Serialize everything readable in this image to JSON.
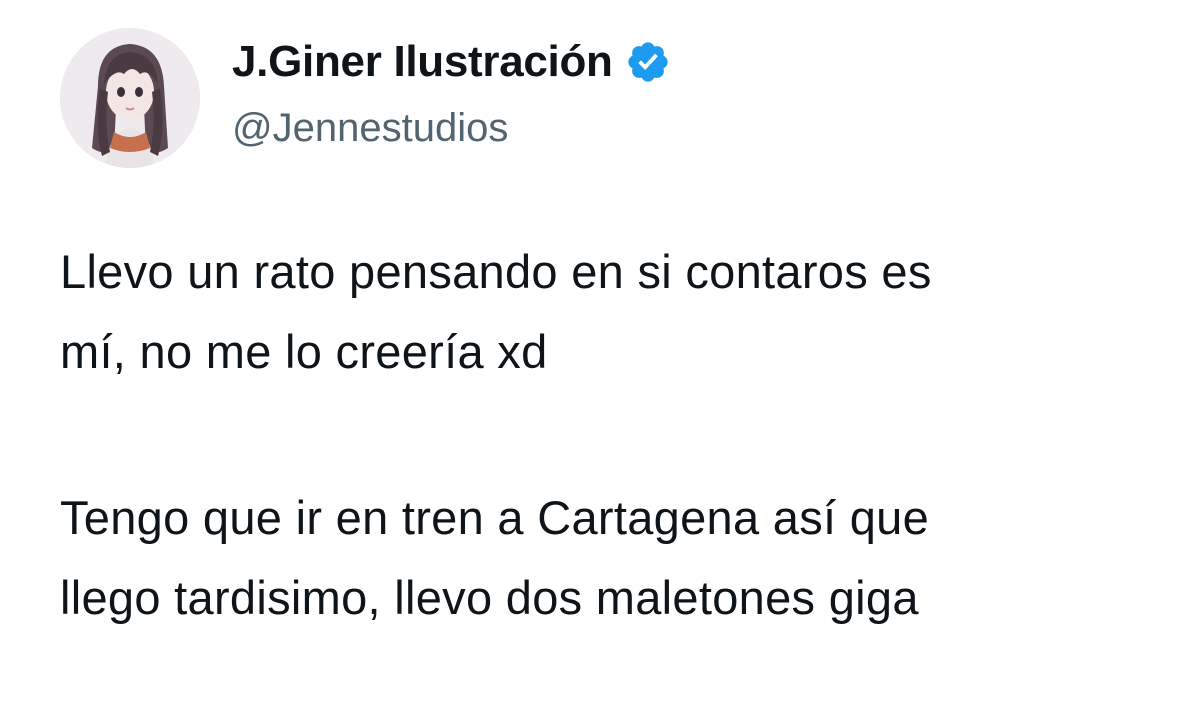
{
  "author": {
    "display_name": "J.Giner Ilustración",
    "handle": "@Jennestudios",
    "verified": true,
    "avatar_icon": "profile-avatar",
    "verified_icon": "verified-badge-icon",
    "verified_color": "#1d9bf0"
  },
  "tweet": {
    "paragraph1": {
      "line1": "Llevo un rato pensando en si contaros es",
      "line2": "mí, no me lo creería xd"
    },
    "paragraph2": {
      "line1": "Tengo que ir en tren a Cartagena así que",
      "line2": "llego tardisimo, llevo dos maletones giga"
    }
  },
  "colors": {
    "text": "#0f1419",
    "secondary": "#536471",
    "background": "#ffffff"
  }
}
